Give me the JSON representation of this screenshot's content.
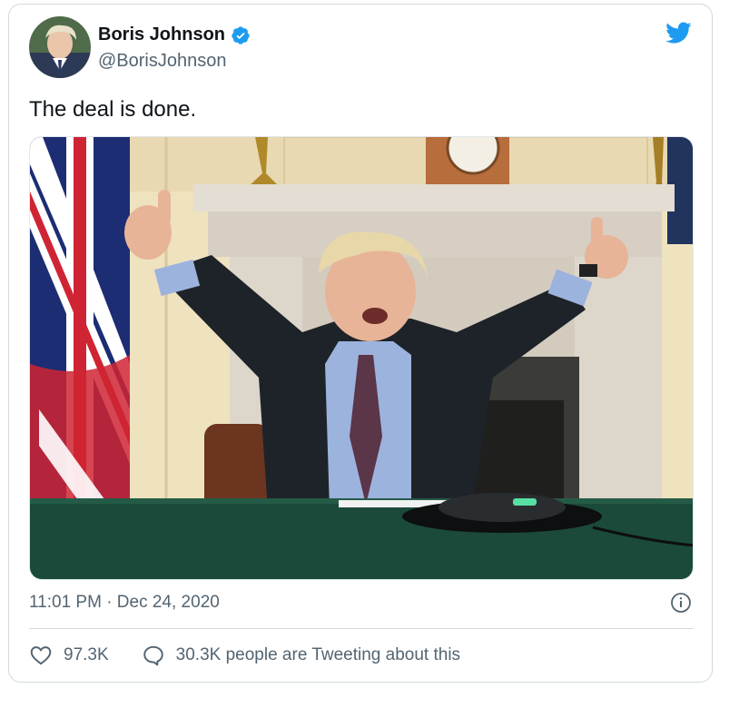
{
  "tweet": {
    "author_name": "Boris Johnson",
    "author_handle": "@BorisJohnson",
    "text": "The deal is done.",
    "timestamp": "11:01 PM · Dec 24, 2020",
    "likes": "97.3K",
    "conversation": "30.3K people are Tweeting about this",
    "icons": {
      "logo": "twitter-bird-icon",
      "verified": "verified-badge-icon",
      "info": "info-icon",
      "like": "heart-icon",
      "reply": "speech-bubble-icon"
    },
    "colors": {
      "brand": "#1d9bf0",
      "text": "#0f1419",
      "secondary": "#536471",
      "border": "#cfd9de"
    }
  }
}
